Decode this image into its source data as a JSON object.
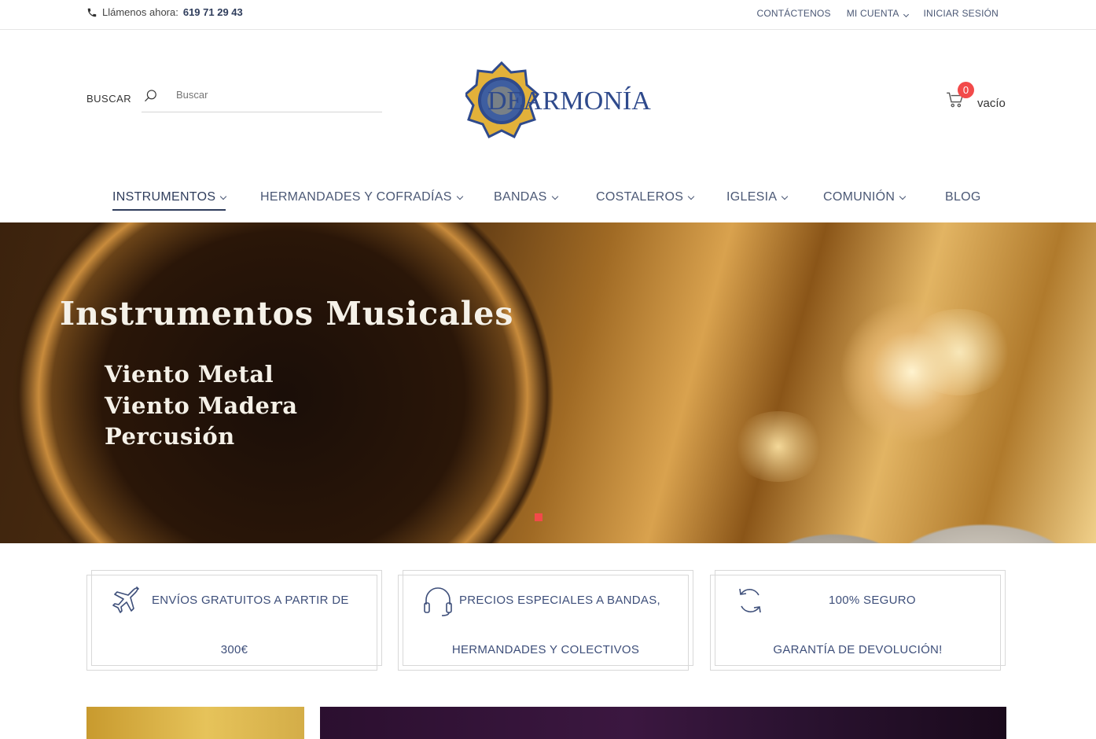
{
  "topbar": {
    "phone_label": "Llámenos ahora:",
    "phone_number": "619 71 29 43",
    "links": [
      "CONTÁCTENOS",
      "MI CUENTA",
      "INICIAR SESIÓN"
    ]
  },
  "header": {
    "search_label": "BUSCAR",
    "search_placeholder": "Buscar",
    "logo_text": "DEARMONÍA",
    "cart_count": "0",
    "cart_label": "vacío"
  },
  "nav": {
    "items": [
      "INSTRUMENTOS",
      "HERMANDADES Y COFRADÍAS",
      "BANDAS",
      "COSTALEROS",
      "IGLESIA",
      "COMUNIÓN",
      "BLOG"
    ]
  },
  "hero": {
    "title": "Instrumentos Musicales",
    "lines": [
      "Viento Metal",
      "Viento Madera",
      "Percusión"
    ]
  },
  "features": [
    {
      "icon": "airplane-icon",
      "line1": "ENVÍOS GRATUITOS A PARTIR DE",
      "line2": "300€"
    },
    {
      "icon": "headset-icon",
      "line1": "PRECIOS ESPECIALES A BANDAS,",
      "line2": "HERMANDADES Y COLECTIVOS"
    },
    {
      "icon": "refresh-icon",
      "line1": "100% SEGURO",
      "line2": "GARANTÍA DE DEVOLUCIÓN!"
    }
  ],
  "colors": {
    "accent": "#f24a4a",
    "nav_text": "#4b5875",
    "logo_blue": "#2f4a8c",
    "logo_gold": "#e2b13a"
  }
}
